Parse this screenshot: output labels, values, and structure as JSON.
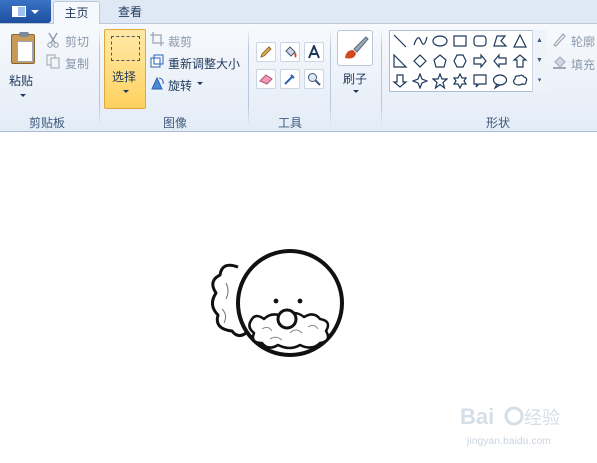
{
  "app_menu_button": {
    "icon": "app-menu-icon"
  },
  "tabs": [
    {
      "label": "主页",
      "active": true
    },
    {
      "label": "查看",
      "active": false
    }
  ],
  "clipboard": {
    "group_label": "剪贴板",
    "paste_label": "粘贴",
    "cut_label": "剪切",
    "copy_label": "复制"
  },
  "image": {
    "group_label": "图像",
    "select_label": "选择",
    "crop_label": "裁剪",
    "resize_label": "重新调整大小",
    "rotate_label": "旋转"
  },
  "tools": {
    "group_label": "工具",
    "items": [
      "pencil-icon",
      "fill-bucket-icon",
      "text-icon",
      "eraser-icon",
      "color-picker-icon",
      "magnifier-icon"
    ]
  },
  "brushes": {
    "label": "刷子"
  },
  "shapes": {
    "group_label": "形状",
    "outline_label": "轮廓",
    "fill_label": "填充"
  },
  "watermark": {
    "text": "jingyan.baidu.com"
  },
  "colors": {
    "accent": "#2b62b6",
    "select_active": "#ffd25f",
    "ribbon": "#e4ecf7"
  }
}
